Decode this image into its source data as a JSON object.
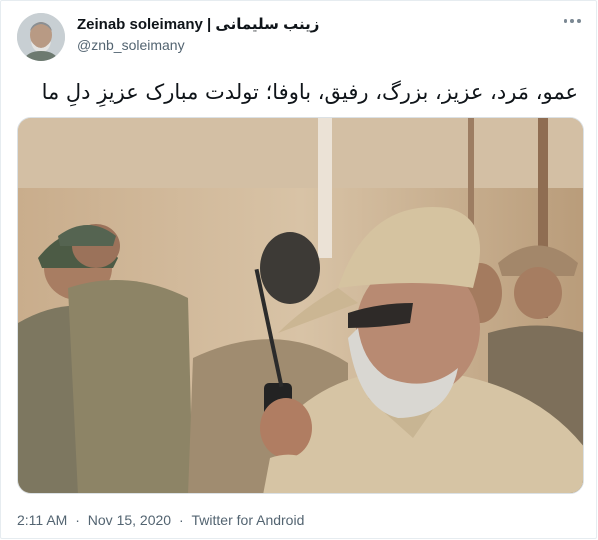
{
  "tweet": {
    "author": {
      "display_name": "Zeinab soleimany | زینب سلیمانی",
      "handle": "@znb_soleimany"
    },
    "text": "عمو، مَرد، عزیز، بزرگ، رفیق، باوفا؛ تولدت مبارک عزیزِ دلِ ما",
    "time": "2:11 AM",
    "date": "Nov 15, 2020",
    "source": "Twitter for Android",
    "separator": "·"
  },
  "icons": {
    "more": "more-horizontal-icon"
  },
  "colors": {
    "text": "#0f1419",
    "secondary": "#536471",
    "border": "#e6ecf0"
  }
}
